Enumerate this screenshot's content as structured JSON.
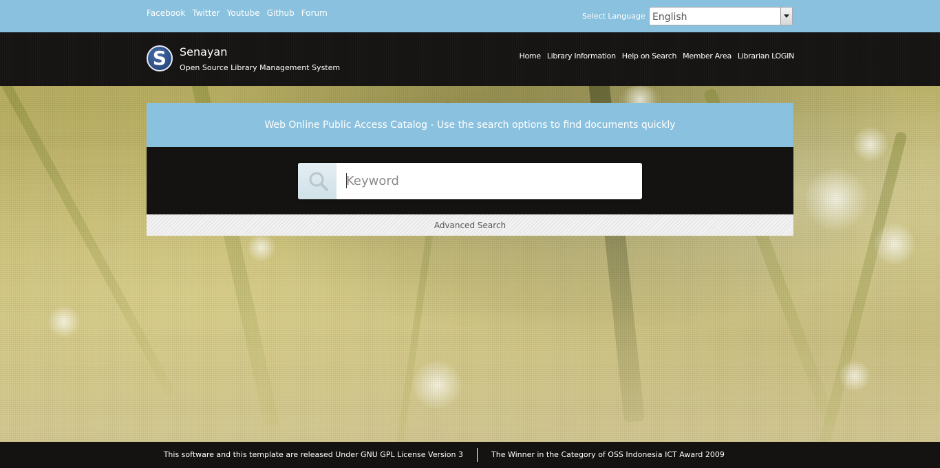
{
  "topbar": {
    "social_links": [
      "Facebook",
      "Twitter",
      "Youtube",
      "Github",
      "Forum"
    ],
    "language_label": "Select Language",
    "language_value": "English"
  },
  "header": {
    "logo_letter": "S",
    "site_name": "Senayan",
    "site_subtitle": "Open Source Library Management System",
    "nav": [
      "Home",
      "Library Information",
      "Help on Search",
      "Member Area",
      "Librarian LOGIN"
    ]
  },
  "search": {
    "heading": "Web Online Public Access Catalog - Use the search options to find documents quickly",
    "placeholder": "Keyword",
    "advanced_label": "Advanced Search"
  },
  "footer": {
    "license": "This software and this template are released Under GNU GPL License Version 3",
    "award": "The Winner in the Category of OSS Indonesia ICT Award 2009"
  },
  "colors": {
    "accent": "#8ac1de",
    "dark": "#141311"
  }
}
